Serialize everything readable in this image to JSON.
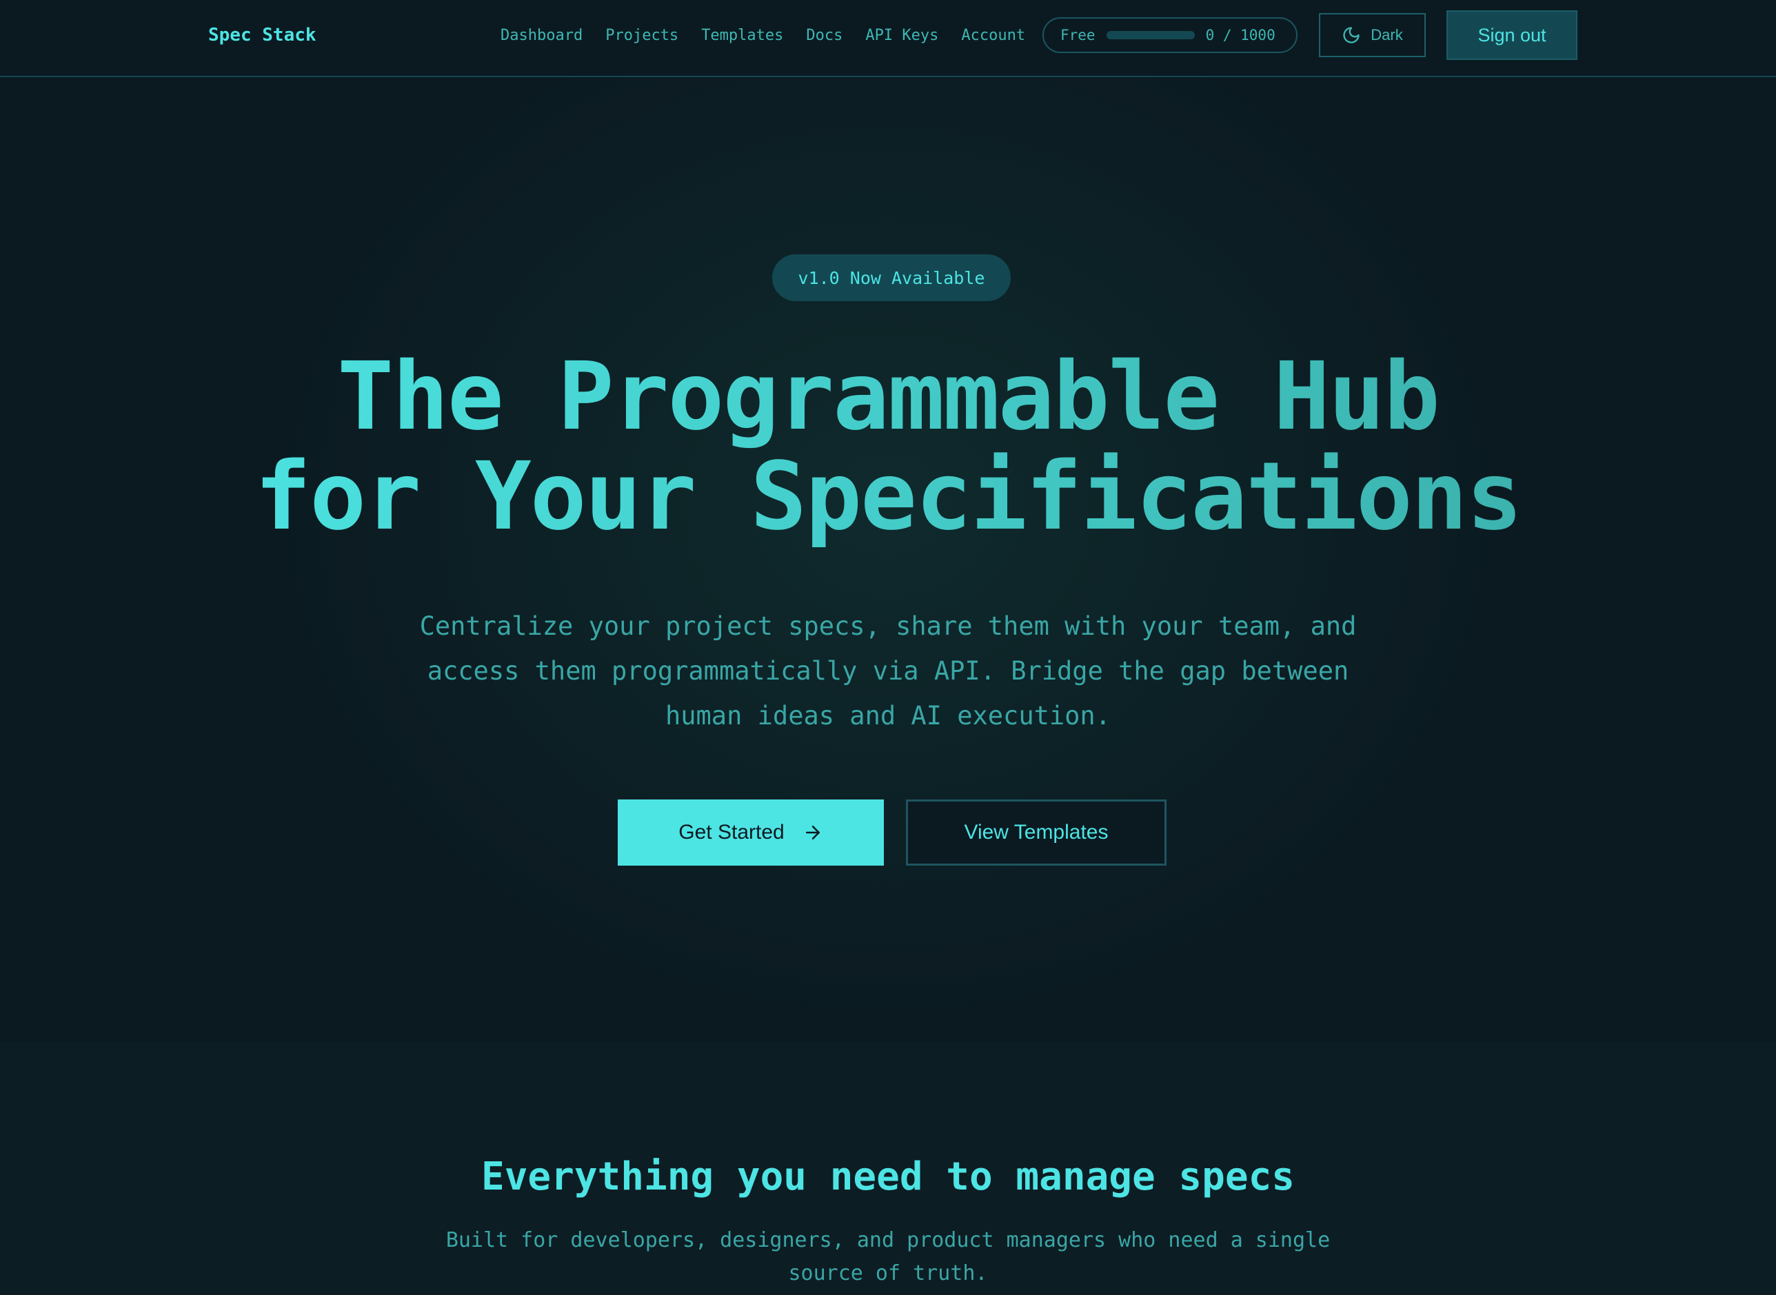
{
  "nav": {
    "brand": "Spec Stack",
    "links": [
      "Dashboard",
      "Projects",
      "Templates",
      "Docs",
      "API Keys",
      "Account"
    ],
    "usage": {
      "plan": "Free",
      "used": 0,
      "limit": 1000,
      "count_label": "0 / 1000"
    },
    "theme_label": "Dark",
    "signout_label": "Sign out"
  },
  "hero": {
    "badge": "v1.0 Now Available",
    "title_line1": "The Programmable Hub",
    "title_line2": "for Your Specifications",
    "subtitle": "Centralize your project specs, share them with your team, and access them programmatically via API. Bridge the gap between human ideas and AI execution.",
    "cta_primary": "Get Started",
    "cta_secondary": "View Templates"
  },
  "features": {
    "title": "Everything you need to manage specs",
    "subtitle": "Built for developers, designers, and product managers who need a single source of truth."
  },
  "icons": {
    "theme": "moon-icon",
    "cta_primary": "arrow-right-icon"
  },
  "colors": {
    "background": "#0b1a21",
    "accent": "#4de4e4",
    "text_muted": "#3fb8b4",
    "surface": "#134852"
  }
}
